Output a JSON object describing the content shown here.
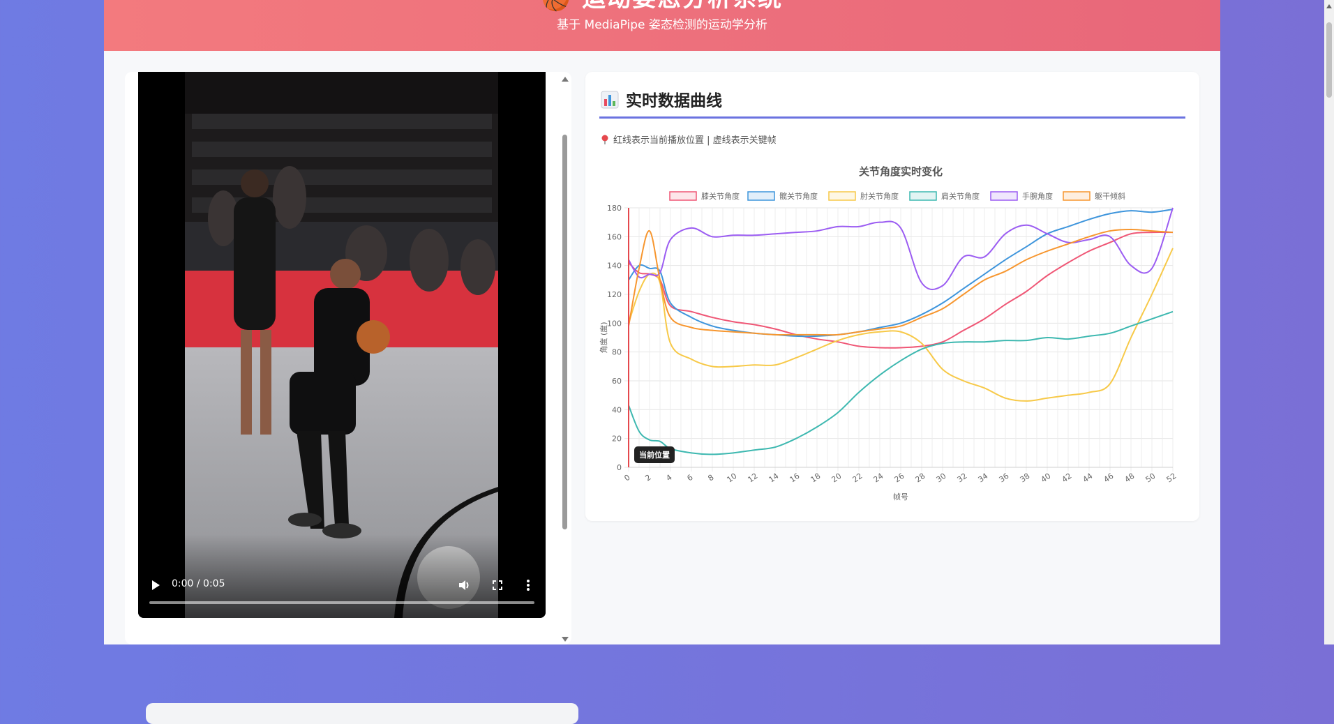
{
  "header": {
    "title": "🏀 运动姿态分析系统",
    "subtitle": "基于 MediaPipe 姿态检测的运动学分析"
  },
  "video": {
    "time": "0:00 / 0:05",
    "progress": 0
  },
  "chart_panel": {
    "heading": "实时数据曲线",
    "hint": "红线表示当前播放位置 | 虚线表示关键帧",
    "current_label": "当前位置"
  },
  "chart_data": {
    "type": "line",
    "title": "关节角度实时变化",
    "xlabel": "帧号",
    "ylabel": "角度 (度)",
    "xlim": [
      0,
      52
    ],
    "ylim": [
      0,
      180
    ],
    "x_ticks": [
      0,
      2,
      4,
      6,
      8,
      10,
      12,
      14,
      16,
      18,
      20,
      22,
      24,
      26,
      28,
      30,
      32,
      34,
      36,
      38,
      40,
      42,
      44,
      46,
      48,
      50,
      52
    ],
    "y_ticks": [
      0,
      20,
      40,
      60,
      80,
      100,
      120,
      140,
      160,
      180
    ],
    "current_frame": 0,
    "legend_position": "top",
    "grid": true,
    "x": [
      0,
      1,
      2,
      3,
      4,
      6,
      8,
      10,
      12,
      14,
      16,
      18,
      20,
      22,
      24,
      26,
      28,
      30,
      32,
      34,
      36,
      38,
      40,
      42,
      44,
      46,
      48,
      50,
      52
    ],
    "series": [
      {
        "name": "膝关节角度",
        "color": "#ef5675",
        "values": [
          142,
          135,
          134,
          130,
          112,
          108,
          104,
          101,
          99,
          96,
          92,
          89,
          87,
          84,
          83,
          83,
          84,
          87,
          95,
          103,
          113,
          122,
          133,
          142,
          150,
          156,
          162,
          163,
          163
        ]
      },
      {
        "name": "髋关节角度",
        "color": "#3e95dc",
        "values": [
          130,
          140,
          138,
          136,
          114,
          104,
          98,
          95,
          93,
          92,
          91,
          91,
          92,
          94,
          97,
          100,
          106,
          114,
          124,
          134,
          144,
          153,
          162,
          167,
          172,
          176,
          178,
          177,
          179
        ]
      },
      {
        "name": "肘关节角度",
        "color": "#f7c948",
        "values": [
          100,
          122,
          134,
          128,
          86,
          75,
          70,
          70,
          71,
          71,
          76,
          82,
          88,
          92,
          94,
          94,
          86,
          68,
          60,
          55,
          48,
          46,
          48,
          50,
          52,
          58,
          90,
          120,
          152
        ]
      },
      {
        "name": "肩关节角度",
        "color": "#3db8b0",
        "values": [
          43,
          25,
          19,
          18,
          13,
          10,
          9,
          10,
          12,
          14,
          20,
          28,
          38,
          52,
          64,
          74,
          82,
          86,
          87,
          87,
          88,
          88,
          90,
          89,
          91,
          93,
          98,
          103,
          108
        ]
      },
      {
        "name": "手腕角度",
        "color": "#9b5cf2",
        "values": [
          144,
          132,
          134,
          135,
          158,
          166,
          160,
          161,
          161,
          162,
          163,
          164,
          167,
          167,
          170,
          166,
          128,
          126,
          146,
          146,
          162,
          168,
          162,
          156,
          158,
          160,
          140,
          138,
          180
        ]
      },
      {
        "name": "躯干倾斜",
        "color": "#f7962e",
        "values": [
          98,
          138,
          164,
          130,
          104,
          97,
          95,
          94,
          93,
          92,
          92,
          92,
          92,
          94,
          96,
          98,
          104,
          110,
          120,
          130,
          136,
          144,
          150,
          155,
          160,
          164,
          165,
          164,
          163
        ]
      }
    ]
  }
}
